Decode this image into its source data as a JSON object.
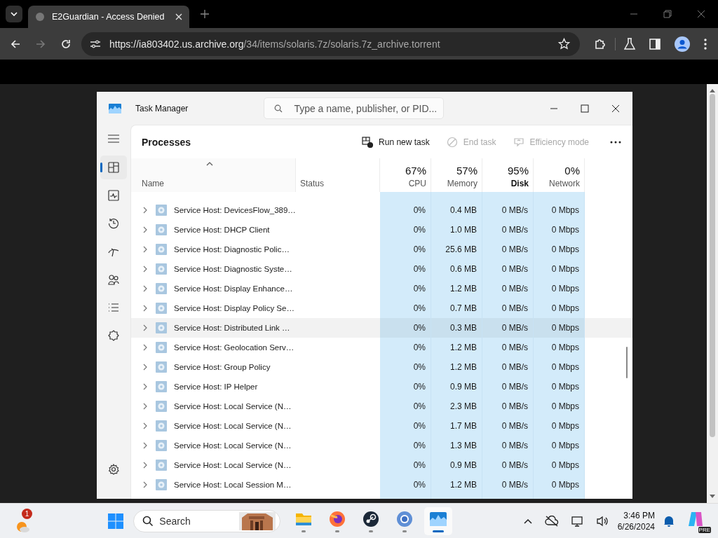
{
  "browser": {
    "tab": {
      "title": "E2Guardian - Access Denied"
    },
    "url": {
      "host": "https://ia803402.us.archive.org",
      "path": "/34/items/solaris.7z/solaris.7z_archive.torrent"
    }
  },
  "task_manager": {
    "title": "Task Manager",
    "search": {
      "placeholder": "Type a name, publisher, or PID..."
    },
    "nav": [
      {
        "kind": "processes",
        "selected": true
      },
      {
        "kind": "performance",
        "selected": false
      },
      {
        "kind": "history",
        "selected": false
      },
      {
        "kind": "startup",
        "selected": false
      },
      {
        "kind": "users",
        "selected": false
      },
      {
        "kind": "details",
        "selected": false
      },
      {
        "kind": "services",
        "selected": false
      }
    ],
    "page_title": "Processes",
    "toolbar": [
      {
        "kind": "run",
        "label": "Run new task",
        "disabled": false
      },
      {
        "kind": "end",
        "label": "End task",
        "disabled": true
      },
      {
        "kind": "efficiency",
        "label": "Efficiency mode",
        "disabled": true
      }
    ],
    "columns": [
      {
        "label": "Name"
      },
      {
        "label": "Status"
      },
      {
        "usage": "67%",
        "label": "CPU",
        "emphasized": false
      },
      {
        "usage": "57%",
        "label": "Memory",
        "emphasized": false
      },
      {
        "usage": "95%",
        "label": "Disk",
        "emphasized": true
      },
      {
        "usage": "0%",
        "label": "Network",
        "emphasized": false
      }
    ],
    "rows": [
      {
        "name": "Service Host: DevicesFlow_389…",
        "cpu": "0%",
        "memory": "0.4 MB",
        "disk": "0 MB/s",
        "network": "0 Mbps",
        "hovered": false
      },
      {
        "name": "Service Host: DHCP Client",
        "cpu": "0%",
        "memory": "1.0 MB",
        "disk": "0 MB/s",
        "network": "0 Mbps",
        "hovered": false
      },
      {
        "name": "Service Host: Diagnostic Polic…",
        "cpu": "0%",
        "memory": "25.6 MB",
        "disk": "0 MB/s",
        "network": "0 Mbps",
        "hovered": false
      },
      {
        "name": "Service Host: Diagnostic Syste…",
        "cpu": "0%",
        "memory": "0.6 MB",
        "disk": "0 MB/s",
        "network": "0 Mbps",
        "hovered": false
      },
      {
        "name": "Service Host: Display Enhance…",
        "cpu": "0%",
        "memory": "1.2 MB",
        "disk": "0 MB/s",
        "network": "0 Mbps",
        "hovered": false
      },
      {
        "name": "Service Host: Display Policy Se…",
        "cpu": "0%",
        "memory": "0.7 MB",
        "disk": "0 MB/s",
        "network": "0 Mbps",
        "hovered": false
      },
      {
        "name": "Service Host: Distributed Link …",
        "cpu": "0%",
        "memory": "0.3 MB",
        "disk": "0 MB/s",
        "network": "0 Mbps",
        "hovered": true
      },
      {
        "name": "Service Host: Geolocation Serv…",
        "cpu": "0%",
        "memory": "1.2 MB",
        "disk": "0 MB/s",
        "network": "0 Mbps",
        "hovered": false
      },
      {
        "name": "Service Host: Group Policy",
        "cpu": "0%",
        "memory": "1.2 MB",
        "disk": "0 MB/s",
        "network": "0 Mbps",
        "hovered": false
      },
      {
        "name": "Service Host: IP Helper",
        "cpu": "0%",
        "memory": "0.9 MB",
        "disk": "0 MB/s",
        "network": "0 Mbps",
        "hovered": false
      },
      {
        "name": "Service Host: Local Service (N…",
        "cpu": "0%",
        "memory": "2.3 MB",
        "disk": "0 MB/s",
        "network": "0 Mbps",
        "hovered": false
      },
      {
        "name": "Service Host: Local Service (N…",
        "cpu": "0%",
        "memory": "1.7 MB",
        "disk": "0 MB/s",
        "network": "0 Mbps",
        "hovered": false
      },
      {
        "name": "Service Host: Local Service (N…",
        "cpu": "0%",
        "memory": "1.3 MB",
        "disk": "0 MB/s",
        "network": "0 Mbps",
        "hovered": false
      },
      {
        "name": "Service Host: Local Service (N…",
        "cpu": "0%",
        "memory": "0.9 MB",
        "disk": "0 MB/s",
        "network": "0 Mbps",
        "hovered": false
      },
      {
        "name": "Service Host: Local Session M…",
        "cpu": "0%",
        "memory": "1.2 MB",
        "disk": "0 MB/s",
        "network": "0 Mbps",
        "hovered": false
      }
    ]
  },
  "taskbar": {
    "weather": {
      "badge": "1"
    },
    "search": {
      "placeholder": "Search"
    },
    "apps": [
      {
        "kind": "explorer",
        "active": false
      },
      {
        "kind": "firefox",
        "active": false
      },
      {
        "kind": "steam",
        "active": false
      },
      {
        "kind": "chrome",
        "active": false
      },
      {
        "kind": "taskmanager",
        "active": true
      }
    ],
    "time": "3:46 PM",
    "date": "6/26/2024",
    "copilot_badge": "PRE"
  }
}
